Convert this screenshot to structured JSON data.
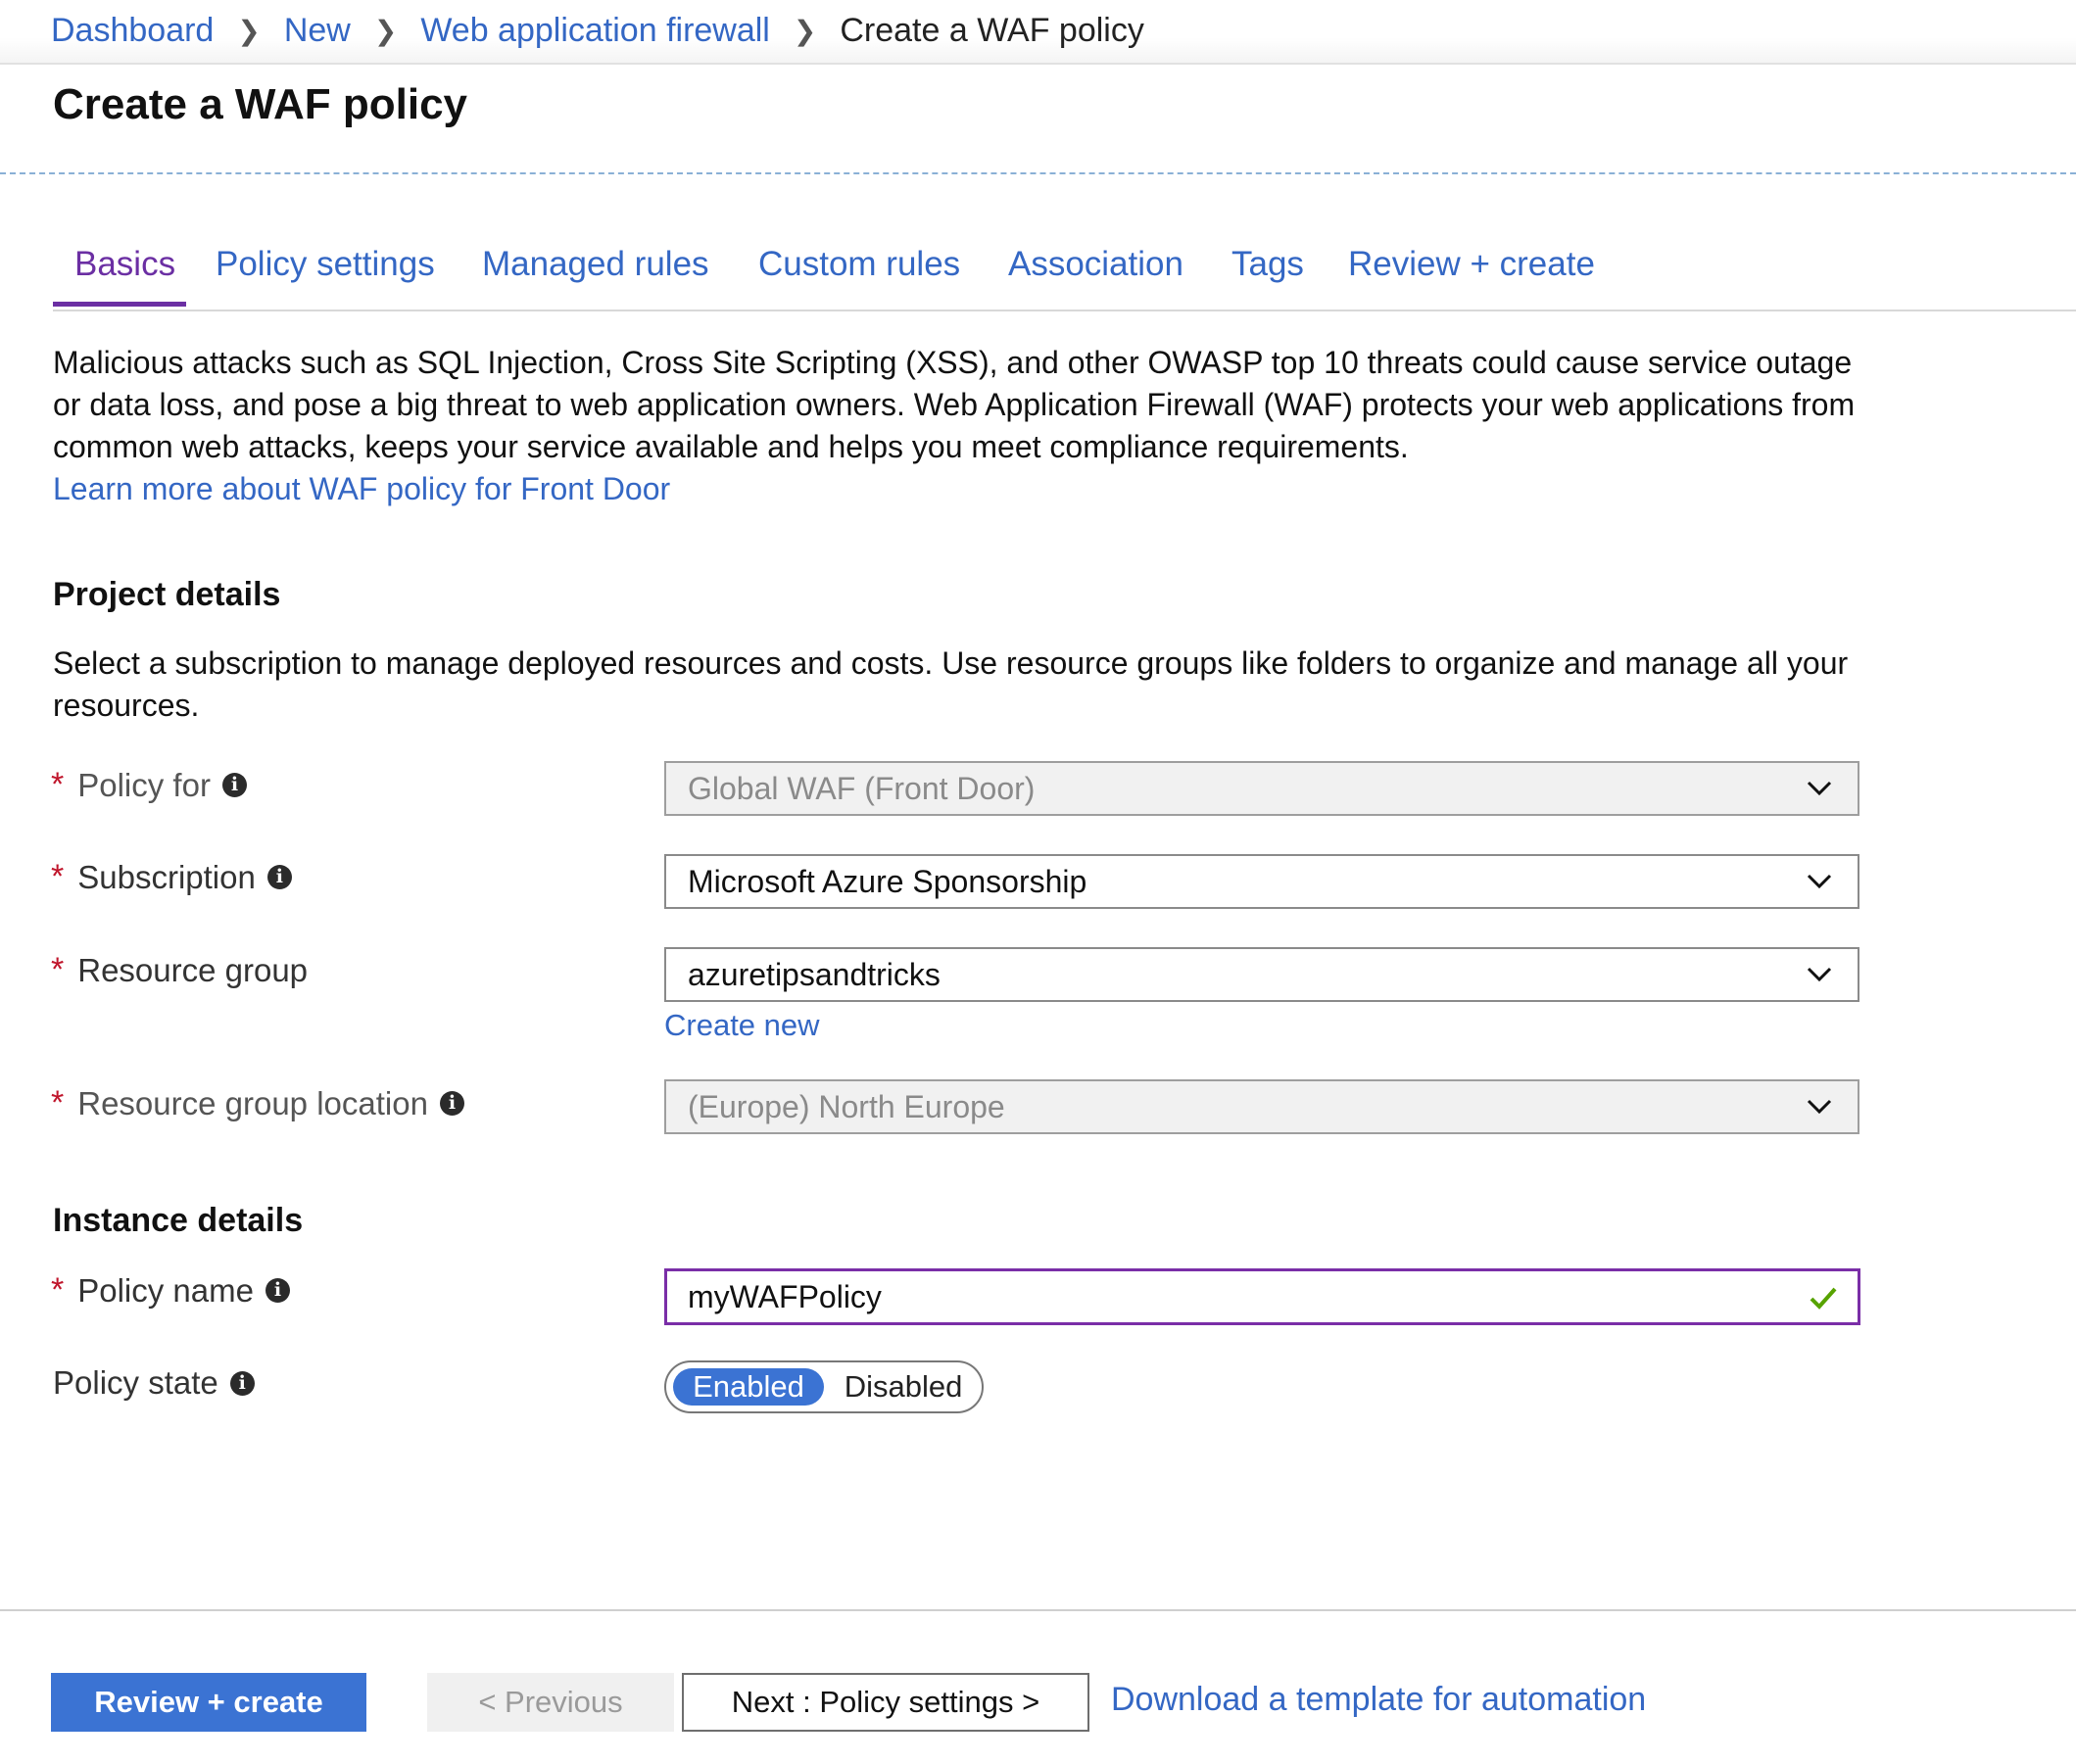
{
  "breadcrumb": {
    "items": [
      "Dashboard",
      "New",
      "Web application firewall"
    ],
    "current": "Create a WAF policy"
  },
  "page_title": "Create a WAF policy",
  "tabs": [
    {
      "label": "Basics",
      "active": true
    },
    {
      "label": "Policy settings",
      "active": false
    },
    {
      "label": "Managed rules",
      "active": false
    },
    {
      "label": "Custom rules",
      "active": false
    },
    {
      "label": "Association",
      "active": false
    },
    {
      "label": "Tags",
      "active": false
    },
    {
      "label": "Review + create",
      "active": false
    }
  ],
  "intro": {
    "text": "Malicious attacks such as SQL Injection, Cross Site Scripting (XSS), and other OWASP top 10 threats could cause service outage or data loss, and pose a big threat to web application owners. Web Application Firewall (WAF) protects your web applications from common web attacks, keeps your service available and helps you meet compliance requirements.",
    "learn_more": "Learn more about WAF policy for Front Door"
  },
  "project_details": {
    "heading": "Project details",
    "description": "Select a subscription to manage deployed resources and costs. Use resource groups like folders to organize and manage all your resources.",
    "required_marker": "*",
    "fields": {
      "policy_for": {
        "label": "Policy for",
        "value": "Global WAF (Front Door)",
        "disabled": true
      },
      "subscription": {
        "label": "Subscription",
        "value": "Microsoft Azure Sponsorship",
        "disabled": false
      },
      "resource_group": {
        "label": "Resource group",
        "value": "azuretipsandtricks",
        "disabled": false,
        "create_new": "Create new"
      },
      "resource_group_location": {
        "label": "Resource group location",
        "value": "(Europe) North Europe",
        "disabled": true
      }
    }
  },
  "instance_details": {
    "heading": "Instance details",
    "policy_name": {
      "label": "Policy name",
      "value": "myWAFPolicy",
      "valid": true
    },
    "policy_state": {
      "label": "Policy state",
      "options": [
        "Enabled",
        "Disabled"
      ],
      "selected": "Enabled"
    }
  },
  "footer": {
    "review_create": "Review + create",
    "previous": "< Previous",
    "next": "Next : Policy settings >",
    "download_template": "Download a template for automation"
  },
  "colors": {
    "link": "#3467c4",
    "active_tab": "#6b2fa3",
    "primary_button": "#3b73d3",
    "required": "#c0162c",
    "valid_check": "#57a300"
  },
  "icons": [
    "chevron-right-icon",
    "info-icon",
    "chevron-down-icon",
    "checkmark-icon"
  ]
}
